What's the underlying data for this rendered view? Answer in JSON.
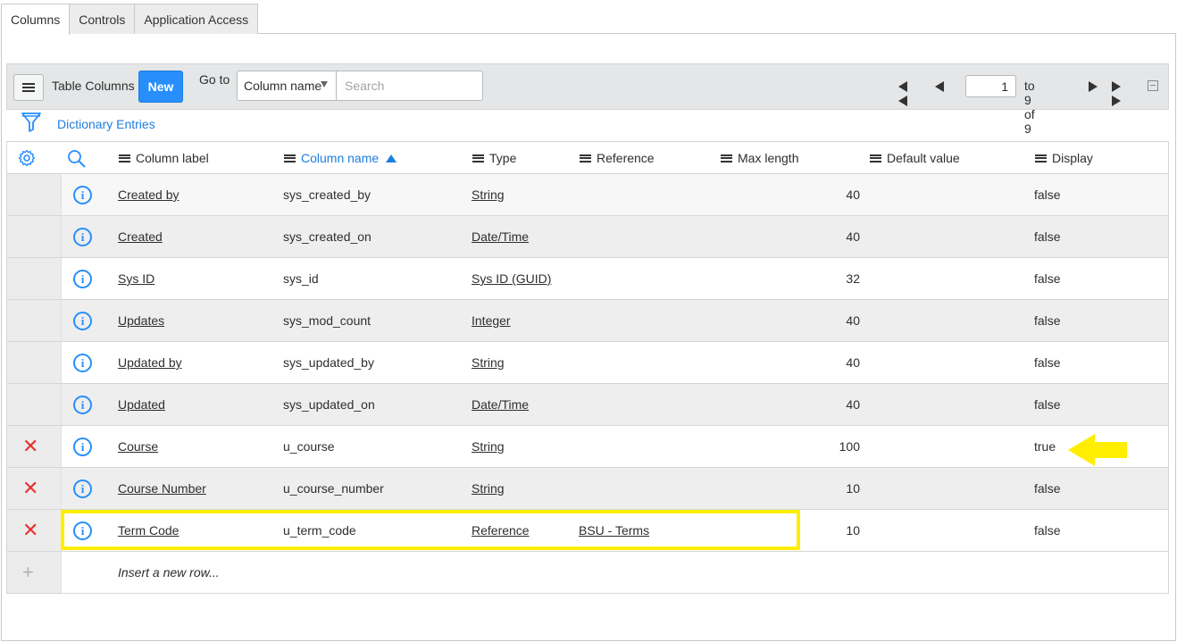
{
  "tabs": [
    {
      "label": "Columns",
      "active": true
    },
    {
      "label": "Controls",
      "active": false
    },
    {
      "label": "Application Access",
      "active": false
    }
  ],
  "toolbar": {
    "menu_icon": "hamburger-icon",
    "title": "Table Columns",
    "new_label": "New",
    "goto_label": "Go to",
    "field_select": "Column name",
    "search_placeholder": "Search",
    "page_value": "1",
    "page_of": "to 9 of 9"
  },
  "breadcrumb": {
    "icon": "filter-icon",
    "label": "Dictionary Entries"
  },
  "columns": {
    "settings_icon": "gear-icon",
    "search_icon": "search-icon",
    "headers": [
      "Column label",
      "Column name",
      "Type",
      "Reference",
      "Max length",
      "Default value",
      "Display"
    ],
    "sorted_column": "Column name",
    "sort_direction": "ascending"
  },
  "rows": [
    {
      "deletable": false,
      "label": "Created by",
      "name": "sys_created_by",
      "type": "String",
      "reference": "",
      "max_length": "40",
      "default_value": "",
      "display": "false"
    },
    {
      "deletable": false,
      "label": "Created",
      "name": "sys_created_on",
      "type": "Date/Time",
      "reference": "",
      "max_length": "40",
      "default_value": "",
      "display": "false"
    },
    {
      "deletable": false,
      "label": "Sys ID",
      "name": "sys_id",
      "type": "Sys ID (GUID)",
      "reference": "",
      "max_length": "32",
      "default_value": "",
      "display": "false"
    },
    {
      "deletable": false,
      "label": "Updates",
      "name": "sys_mod_count",
      "type": "Integer",
      "reference": "",
      "max_length": "40",
      "default_value": "",
      "display": "false"
    },
    {
      "deletable": false,
      "label": "Updated by",
      "name": "sys_updated_by",
      "type": "String",
      "reference": "",
      "max_length": "40",
      "default_value": "",
      "display": "false"
    },
    {
      "deletable": false,
      "label": "Updated",
      "name": "sys_updated_on",
      "type": "Date/Time",
      "reference": "",
      "max_length": "40",
      "default_value": "",
      "display": "false"
    },
    {
      "deletable": true,
      "label": "Course",
      "name": "u_course",
      "type": "String",
      "reference": "",
      "max_length": "100",
      "default_value": "",
      "display": "true"
    },
    {
      "deletable": true,
      "label": "Course Number",
      "name": "u_course_number",
      "type": "String",
      "reference": "",
      "max_length": "10",
      "default_value": "",
      "display": "false"
    },
    {
      "deletable": true,
      "label": "Term Code",
      "name": "u_term_code",
      "type": "Reference",
      "reference": "BSU - Terms",
      "max_length": "10",
      "default_value": "",
      "display": "false"
    }
  ],
  "insert_row_label": "Insert a new row...",
  "colors": {
    "accent": "#278efc",
    "link": "#1f7ee0",
    "delete": "#e8312e",
    "highlight": "#ffee00"
  }
}
